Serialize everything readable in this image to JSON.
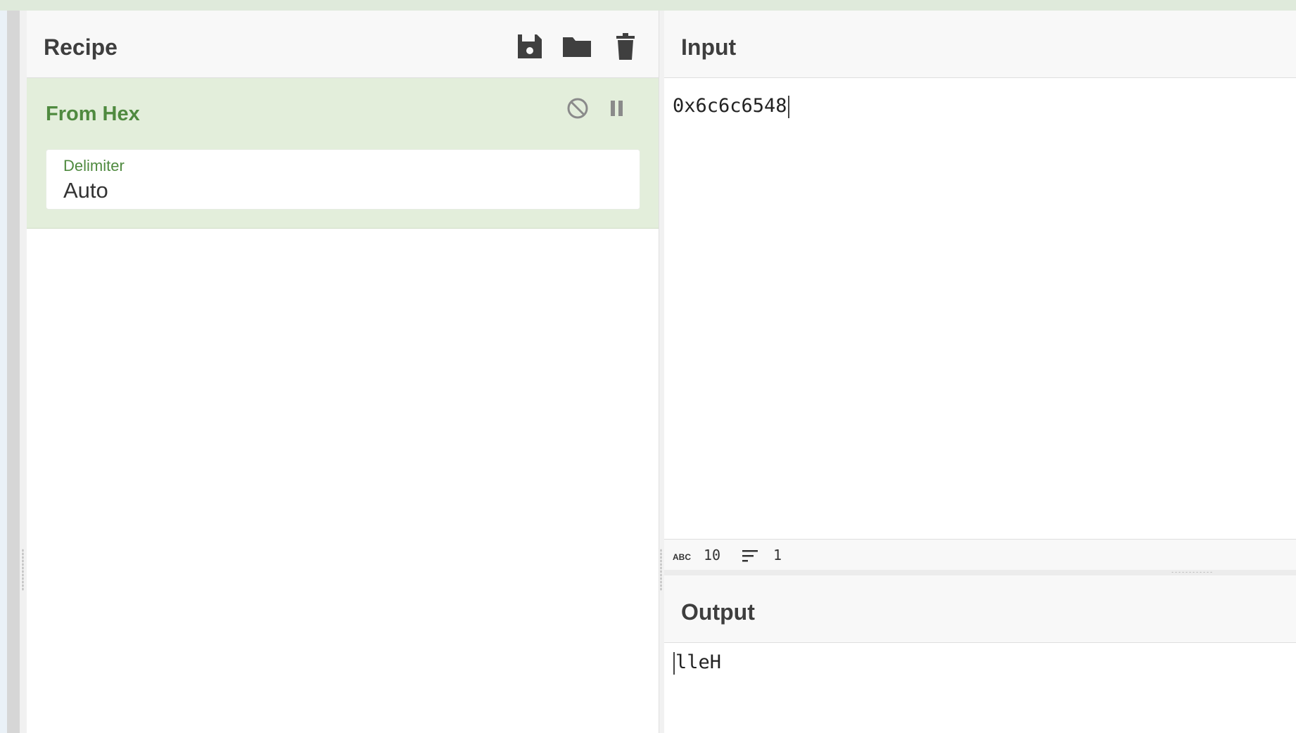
{
  "recipe": {
    "title": "Recipe",
    "icons": [
      "save-icon",
      "folder-open-icon",
      "trash-icon"
    ],
    "operation": {
      "name": "From Hex",
      "arg_label": "Delimiter",
      "arg_value": "Auto",
      "icons": [
        "disable-icon",
        "pause-icon"
      ]
    }
  },
  "input": {
    "title": "Input",
    "text": "0x6c6c6548",
    "status": {
      "length_icon": "abc-length-icon",
      "length": "10",
      "lines_icon": "lines-icon",
      "lines": "1"
    }
  },
  "output": {
    "title": "Output",
    "text": "lleH"
  },
  "colors": {
    "accent_green": "#4f8a3f",
    "card_bg": "#e3eedb",
    "header_bg": "#f8f8f8"
  }
}
